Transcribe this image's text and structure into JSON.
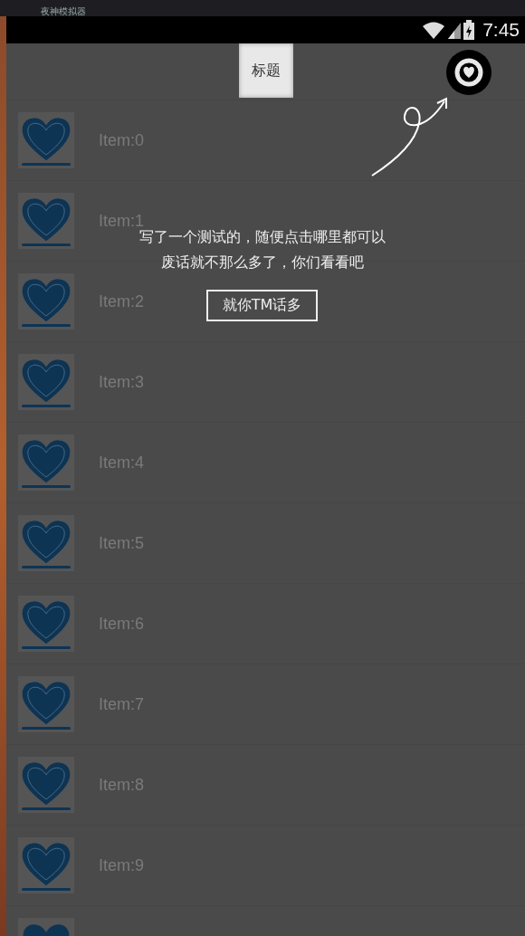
{
  "emulator": {
    "title": "夜神模拟器"
  },
  "status_bar": {
    "time": "7:45"
  },
  "toolbar": {
    "title": "标题"
  },
  "list": {
    "items": [
      {
        "label": "Item:0"
      },
      {
        "label": "Item:1"
      },
      {
        "label": "Item:2"
      },
      {
        "label": "Item:3"
      },
      {
        "label": "Item:4"
      },
      {
        "label": "Item:5"
      },
      {
        "label": "Item:6"
      },
      {
        "label": "Item:7"
      },
      {
        "label": "Item:8"
      },
      {
        "label": "Item:9"
      }
    ]
  },
  "guide": {
    "lines": [
      "写了一个测试的，随便点击哪里都可以",
      "废话就不那么多了，你们看看吧"
    ],
    "button": "就你TM话多"
  }
}
